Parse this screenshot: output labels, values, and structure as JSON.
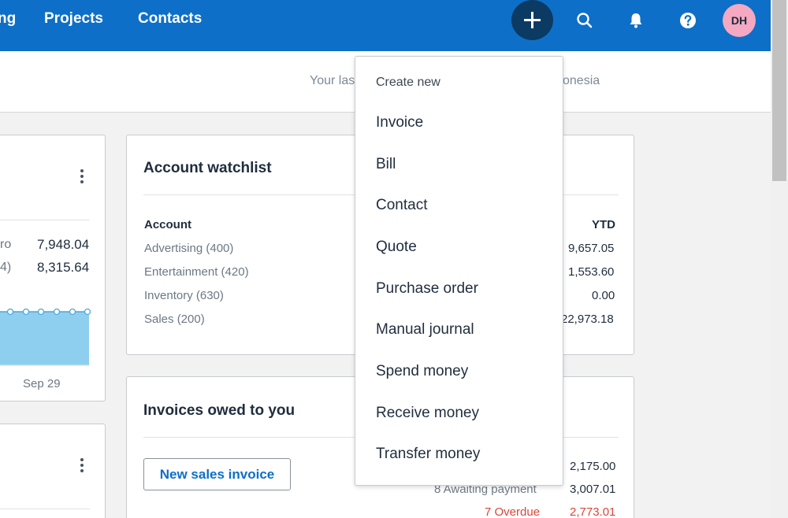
{
  "topnav": {
    "items": [
      {
        "label": "ng"
      },
      {
        "label": "Projects"
      },
      {
        "label": "Contacts"
      }
    ],
    "avatar_initials": "DH",
    "colors": {
      "bar": "#0d6fc7",
      "plus": "#0b3a63",
      "avatar": "#f4a8c1"
    }
  },
  "subheader": {
    "last_login_left": "Your las",
    "last_login_right": "onesia"
  },
  "left_card": {
    "rows": [
      {
        "label": "ro",
        "value": "7,948.04"
      },
      {
        "label": "4)",
        "value": "8,315.64"
      }
    ],
    "x_label": "Sep 29"
  },
  "account_watchlist": {
    "title": "Account watchlist",
    "col_account": "Account",
    "col_ytd": "YTD",
    "rows": [
      {
        "account": "Advertising (400)",
        "ytd": "9,657.05"
      },
      {
        "account": "Entertainment (420)",
        "ytd": "1,553.60"
      },
      {
        "account": "Inventory (630)",
        "ytd": "0.00"
      },
      {
        "account": "Sales (200)",
        "ytd": "22,973.18"
      }
    ]
  },
  "invoices_owed": {
    "title": "Invoices owed to you",
    "new_button": "New sales invoice",
    "rows": [
      {
        "label": "",
        "value": "2,175.00"
      },
      {
        "label": "8 Awaiting payment",
        "value": "3,007.01"
      },
      {
        "label": "7 Overdue",
        "value": "2,773.01"
      }
    ],
    "overdue_color": "#d9463a"
  },
  "create_menu": {
    "header": "Create new",
    "items": [
      {
        "label": "Invoice"
      },
      {
        "label": "Bill"
      },
      {
        "label": "Contact"
      },
      {
        "label": "Quote"
      },
      {
        "label": "Purchase order"
      },
      {
        "label": "Manual journal"
      },
      {
        "label": "Spend money"
      },
      {
        "label": "Receive money"
      },
      {
        "label": "Transfer money"
      }
    ]
  }
}
